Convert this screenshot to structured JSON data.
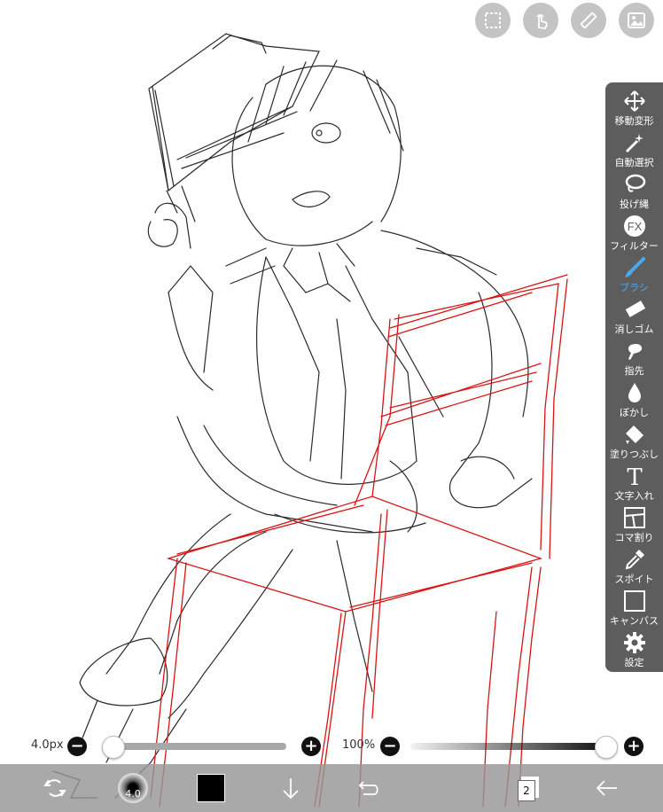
{
  "toolbar": {
    "tools": [
      {
        "label": "移動変形",
        "icon": "move-icon"
      },
      {
        "label": "自動選択",
        "icon": "magic-wand-icon"
      },
      {
        "label": "投げ縄",
        "icon": "lasso-icon"
      },
      {
        "label": "フィルター",
        "icon": "fx-icon"
      },
      {
        "label": "ブラシ",
        "icon": "brush-icon"
      },
      {
        "label": "消しゴム",
        "icon": "eraser-icon"
      },
      {
        "label": "指先",
        "icon": "finger-icon"
      },
      {
        "label": "ぼかし",
        "icon": "blur-drop-icon"
      },
      {
        "label": "塗りつぶし",
        "icon": "fill-icon"
      },
      {
        "label": "文字入れ",
        "icon": "text-icon"
      },
      {
        "label": "コマ割り",
        "icon": "frame-divider-icon"
      },
      {
        "label": "スポイト",
        "icon": "eyedropper-icon"
      },
      {
        "label": "キャンバス",
        "icon": "canvas-icon"
      },
      {
        "label": "設定",
        "icon": "gear-icon"
      }
    ],
    "active_tool": "ブラシ",
    "active_color": "#4aa8f0"
  },
  "fx_text": "FX",
  "text_tool_glyph": "T",
  "top_buttons": [
    "selection-icon",
    "touch-icon",
    "ruler-icon",
    "image-icon"
  ],
  "brush": {
    "size_label": "4.0px",
    "size_fraction": 0.05,
    "opacity_label": "100%",
    "opacity_fraction": 1.0,
    "minus": "−",
    "plus": "+"
  },
  "bottom": {
    "brush_preview_value": "4.0",
    "color": "#000000",
    "layer_count": "2"
  },
  "sketch_colors": {
    "pencil": "#2a2a2a",
    "guide": "#d81414"
  }
}
